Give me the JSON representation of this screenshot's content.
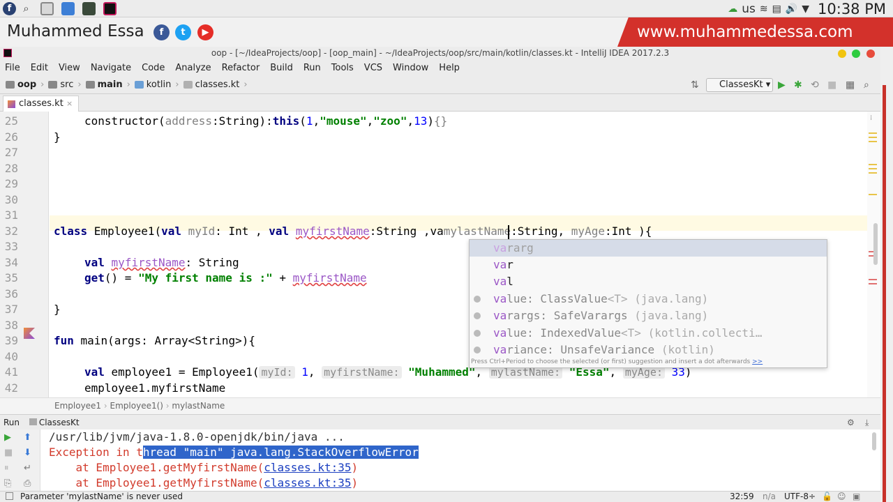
{
  "system": {
    "keyboard": "us",
    "clock": "10:38 PM"
  },
  "banner": {
    "name": "Muhammed Essa",
    "website": "www.muhammedessa.com",
    "social": [
      "f",
      "t",
      "▶"
    ]
  },
  "window": {
    "title": "oop - [~/IdeaProjects/oop] - [oop_main] - ~/IdeaProjects/oop/src/main/kotlin/classes.kt - IntelliJ IDEA 2017.2.3"
  },
  "menu": [
    "File",
    "Edit",
    "View",
    "Navigate",
    "Code",
    "Analyze",
    "Refactor",
    "Build",
    "Run",
    "Tools",
    "VCS",
    "Window",
    "Help"
  ],
  "breadcrumb": [
    "oop",
    "src",
    "main",
    "kotlin",
    "classes.kt"
  ],
  "run_config": "ClassesKt",
  "tab": {
    "label": "classes.kt",
    "close": "×"
  },
  "line_numbers": [
    "25",
    "26",
    "27",
    "28",
    "29",
    "30",
    "31",
    "32",
    "33",
    "34",
    "35",
    "36",
    "37",
    "38",
    "39",
    "40",
    "41",
    "42"
  ],
  "code": {
    "l25_kw": "constructor",
    "l25_p1": "(",
    "l25_param": "address",
    "l25_p2": ":String):",
    "l25_this": "this",
    "l25_p3": "(",
    "l25_n1": "1",
    "l25_c1": ",",
    "l25_s1": "\"mouse\"",
    "l25_c2": ",",
    "l25_s2": "\"zoo\"",
    "l25_c3": ",",
    "l25_n2": "13",
    "l25_p4": ")",
    "l25_braces": "{}",
    "l26": "}",
    "l32_class": "class",
    "l32_name": " Employee1(",
    "l32_val1": "val",
    "l32_id": " myId",
    "l32_t1": ": Int , ",
    "l32_val2": "val",
    "l32_sp": " ",
    "l32_fn": "myfirstName",
    "l32_t2": ":String ,va",
    "l32_ln": "mylastName",
    "l32_t3": ":String, ",
    "l32_age": "myAge",
    "l32_t4": ":Int ){",
    "l34_val": "val",
    "l34_sp": " ",
    "l34_name": "myfirstName",
    "l34_type": ": String",
    "l35_get": "get",
    "l35_p": "() = ",
    "l35_str": "\"My first name is :\"",
    "l35_plus": " + ",
    "l35_ref": "myfirstName",
    "l37": "}",
    "l39_fun": "fun",
    "l39_rest": " main(args: Array<String>){",
    "l41_val": "val",
    "l41_a": " employee1 = Employee1(",
    "l41_h1": "myId:",
    "l41_n1": " 1",
    "l41_c1": ", ",
    "l41_h2": "myfirstName:",
    "l41_s1": " \"Muhammed\"",
    "l41_c2": ", ",
    "l41_h3": "mylastName:",
    "l41_s2": " \"Essa\"",
    "l41_c3": ", ",
    "l41_h4": "myAge:",
    "l41_n2": " 33",
    "l41_end": ")",
    "l42": "employee1.myfirstName"
  },
  "completion": {
    "items": [
      {
        "match": "va",
        "rest": "rarg",
        "detail": ""
      },
      {
        "match": "va",
        "rest": "r",
        "detail": ""
      },
      {
        "match": "va",
        "rest": "l",
        "detail": ""
      },
      {
        "match": "va",
        "rest": "lue: ClassValue",
        "detail": "<T> (java.lang)"
      },
      {
        "match": "va",
        "rest": "rargs: SafeVarargs",
        "detail": " (java.lang)"
      },
      {
        "match": "va",
        "rest": "lue: IndexedValue",
        "detail": "<T> (kotlin.collecti…"
      },
      {
        "match": "va",
        "rest": "riance: UnsafeVariance",
        "detail": " (kotlin)"
      }
    ],
    "hint": "Press Ctrl+Period to choose the selected (or first) suggestion and insert a dot afterwards",
    "hint_link": ">>"
  },
  "editor_breadcrumb": [
    "Employee1",
    "Employee1()",
    "mylastName"
  ],
  "run_panel": {
    "label": "Run",
    "config": "ClassesKt",
    "lines": {
      "cmd": "/usr/lib/jvm/java-1.8.0-openjdk/bin/java ...",
      "err_a": "Exception in t",
      "err_b": "hread \"main\" java.lang.StackOverflowError",
      "at1": "    at Employee1.getMyfirstName(",
      "at1_link": "classes.kt:35",
      "at1_end": ")",
      "at2": "    at Employee1.getMyfirstName(",
      "at2_link": "classes.kt:35",
      "at2_end": ")"
    }
  },
  "status": {
    "message": "Parameter 'mylastName' is never used",
    "position": "32:59",
    "na": "n/a",
    "encoding": "UTF-8÷"
  }
}
